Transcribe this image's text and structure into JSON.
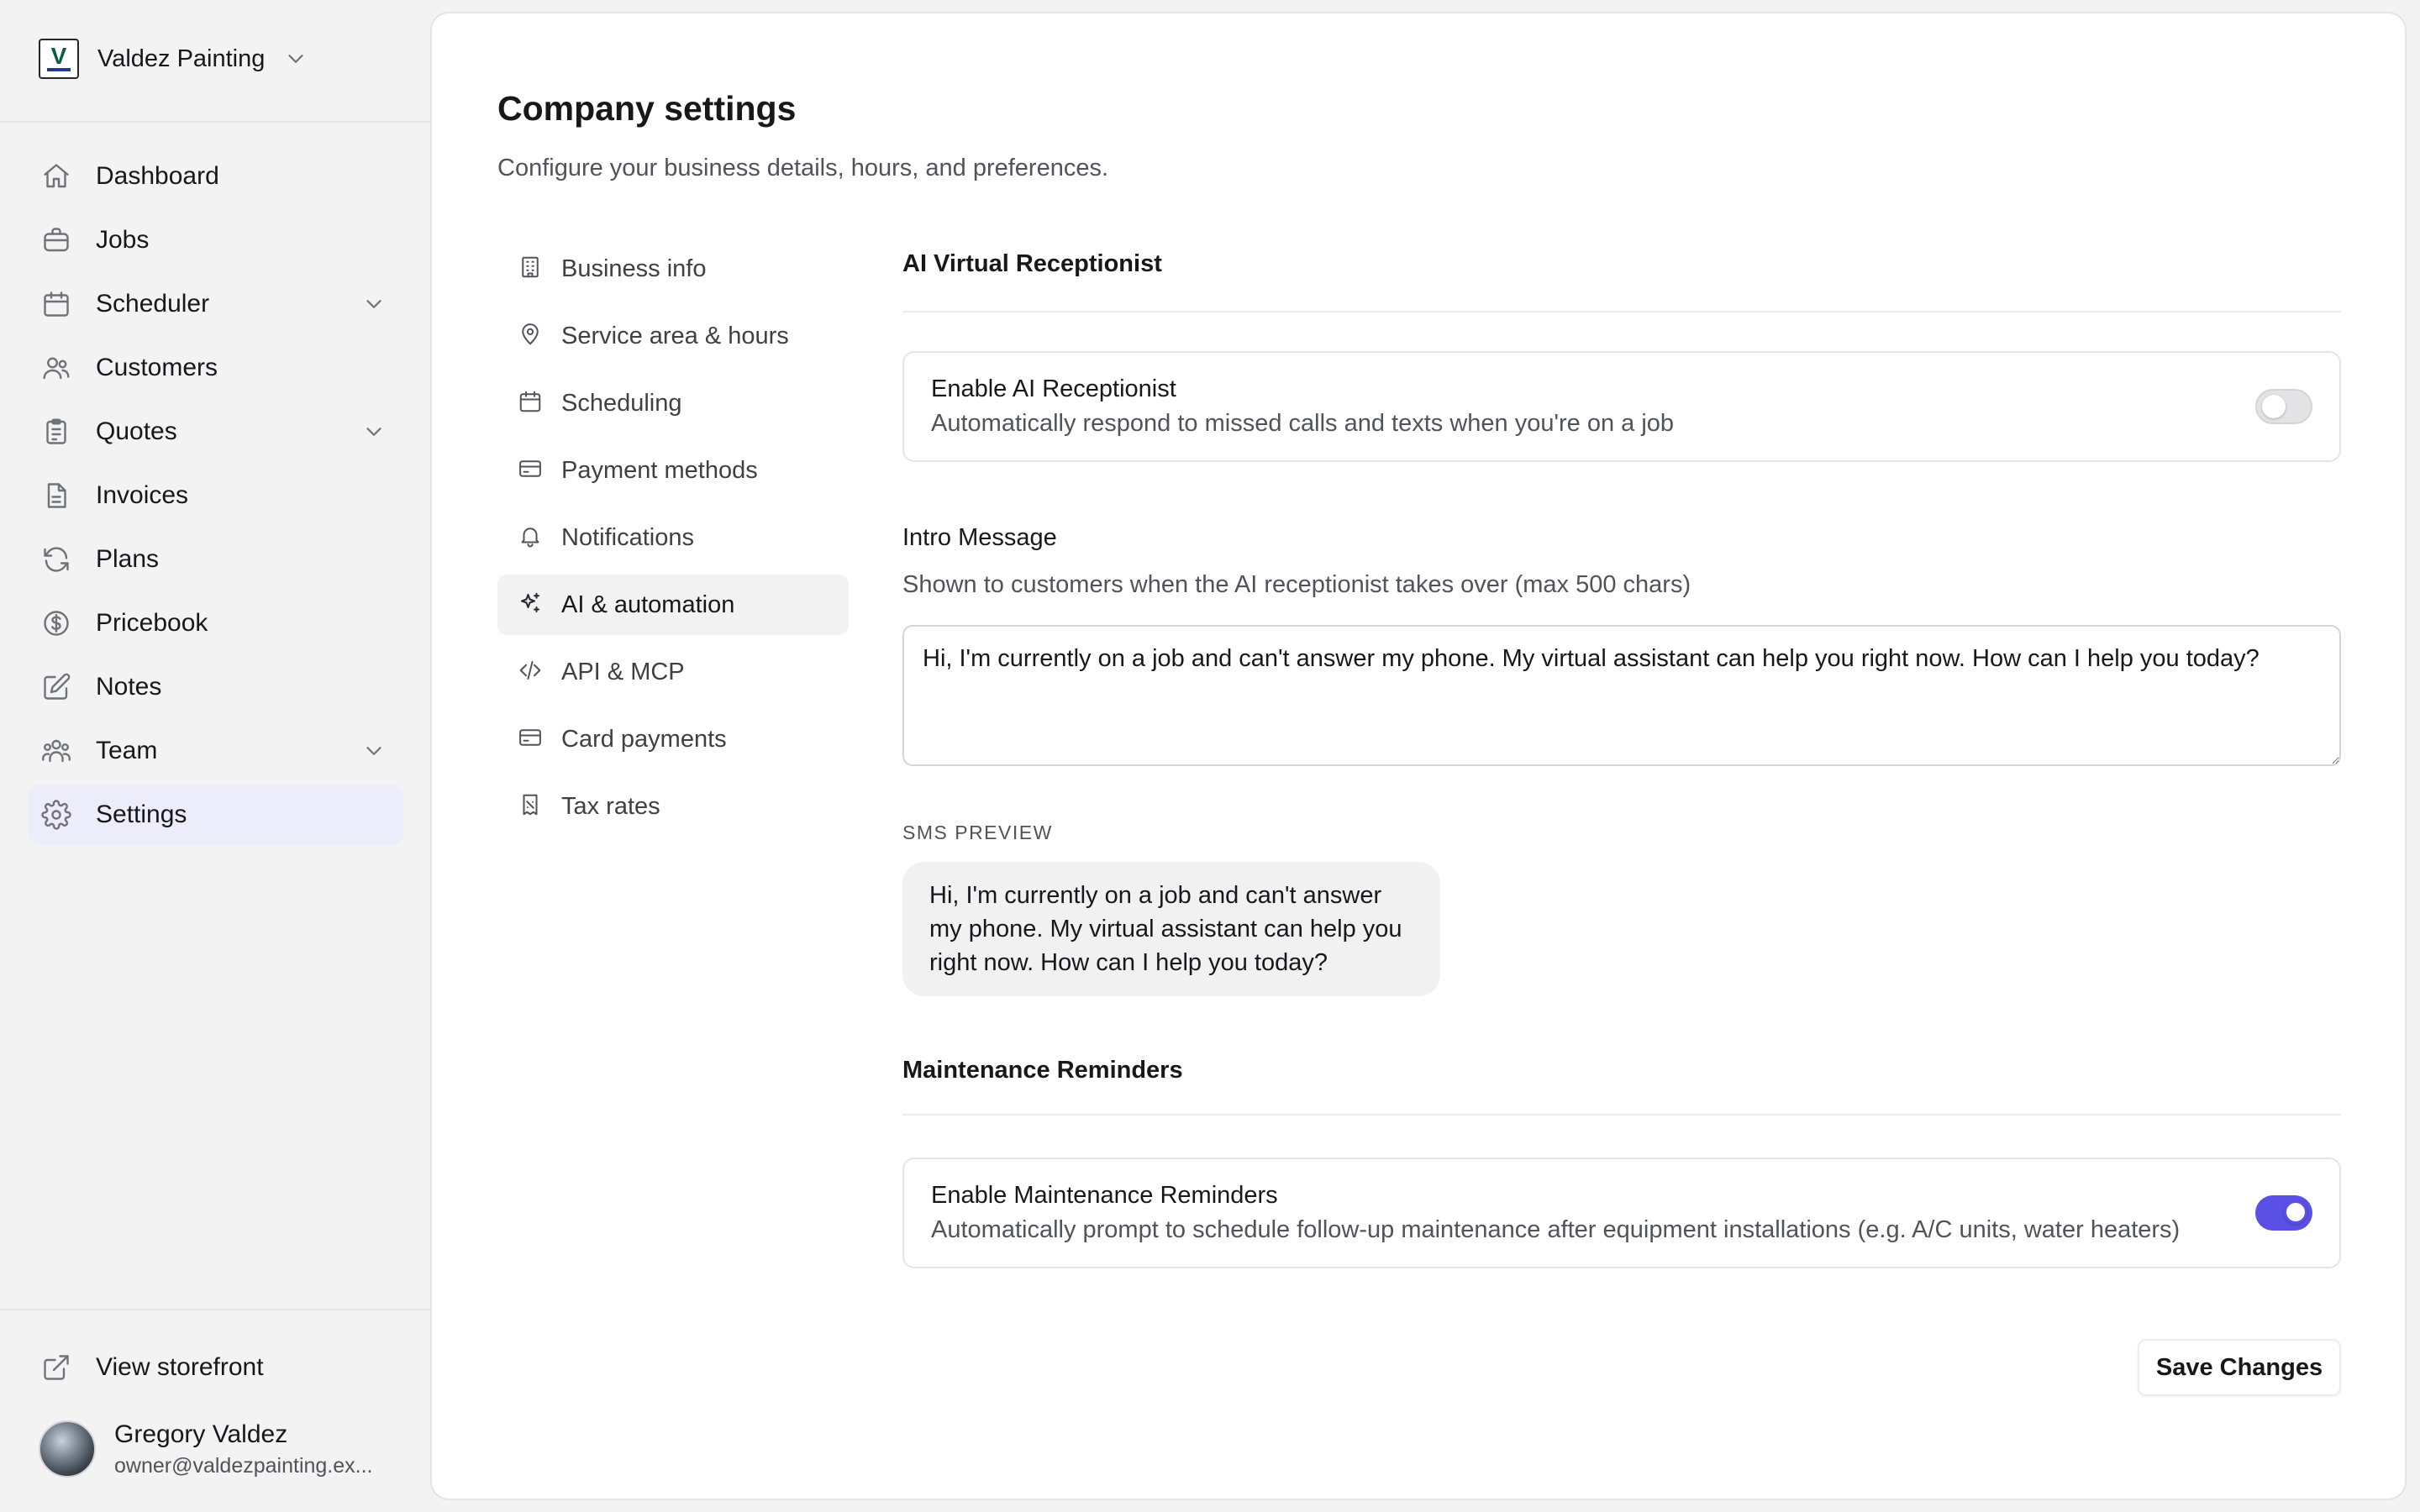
{
  "workspace": {
    "name": "Valdez Painting",
    "logo_letter": "V"
  },
  "sidebar": {
    "items": [
      {
        "label": "Dashboard",
        "icon": "home-icon",
        "has_chevron": false,
        "active": false
      },
      {
        "label": "Jobs",
        "icon": "briefcase-icon",
        "has_chevron": false,
        "active": false
      },
      {
        "label": "Scheduler",
        "icon": "calendar-icon",
        "has_chevron": true,
        "active": false
      },
      {
        "label": "Customers",
        "icon": "users-icon",
        "has_chevron": false,
        "active": false
      },
      {
        "label": "Quotes",
        "icon": "clipboard-icon",
        "has_chevron": true,
        "active": false
      },
      {
        "label": "Invoices",
        "icon": "file-icon",
        "has_chevron": false,
        "active": false
      },
      {
        "label": "Plans",
        "icon": "refresh-icon",
        "has_chevron": false,
        "active": false
      },
      {
        "label": "Pricebook",
        "icon": "dollar-circle-icon",
        "has_chevron": false,
        "active": false
      },
      {
        "label": "Notes",
        "icon": "pencil-square-icon",
        "has_chevron": false,
        "active": false
      },
      {
        "label": "Team",
        "icon": "team-icon",
        "has_chevron": true,
        "active": false
      },
      {
        "label": "Settings",
        "icon": "gear-icon",
        "has_chevron": false,
        "active": true
      }
    ],
    "storefront_label": "View storefront"
  },
  "user": {
    "name": "Gregory Valdez",
    "email": "owner@valdezpainting.ex..."
  },
  "page": {
    "title": "Company settings",
    "subtitle": "Configure your business details, hours, and preferences."
  },
  "settings_nav": [
    {
      "label": "Business info",
      "icon": "building-icon",
      "active": false
    },
    {
      "label": "Service area & hours",
      "icon": "map-pin-icon",
      "active": false
    },
    {
      "label": "Scheduling",
      "icon": "calendar-icon",
      "active": false
    },
    {
      "label": "Payment methods",
      "icon": "credit-card-icon",
      "active": false
    },
    {
      "label": "Notifications",
      "icon": "bell-icon",
      "active": false
    },
    {
      "label": "AI & automation",
      "icon": "sparkles-icon",
      "active": true
    },
    {
      "label": "API & MCP",
      "icon": "code-icon",
      "active": false
    },
    {
      "label": "Card payments",
      "icon": "credit-card-icon",
      "active": false
    },
    {
      "label": "Tax rates",
      "icon": "receipt-icon",
      "active": false
    }
  ],
  "ai_receptionist": {
    "section_title": "AI Virtual Receptionist",
    "toggle_title": "Enable AI Receptionist",
    "toggle_desc": "Automatically respond to missed calls and texts when you're on a job",
    "enabled": false,
    "intro_label": "Intro Message",
    "intro_help": "Shown to customers when the AI receptionist takes over (max 500 chars)",
    "intro_message": "Hi, I'm currently on a job and can't answer my phone. My virtual assistant can help you right now. How can I help you today?",
    "preview_label": "SMS PREVIEW"
  },
  "maintenance": {
    "section_title": "Maintenance Reminders",
    "toggle_title": "Enable Maintenance Reminders",
    "toggle_desc": "Automatically prompt to schedule follow-up maintenance after equipment installations (e.g. A/C units, water heaters)",
    "enabled": true
  },
  "save_label": "Save Changes",
  "colors": {
    "accent": "#5b50e6",
    "active_nav_bg": "#ececfb"
  }
}
